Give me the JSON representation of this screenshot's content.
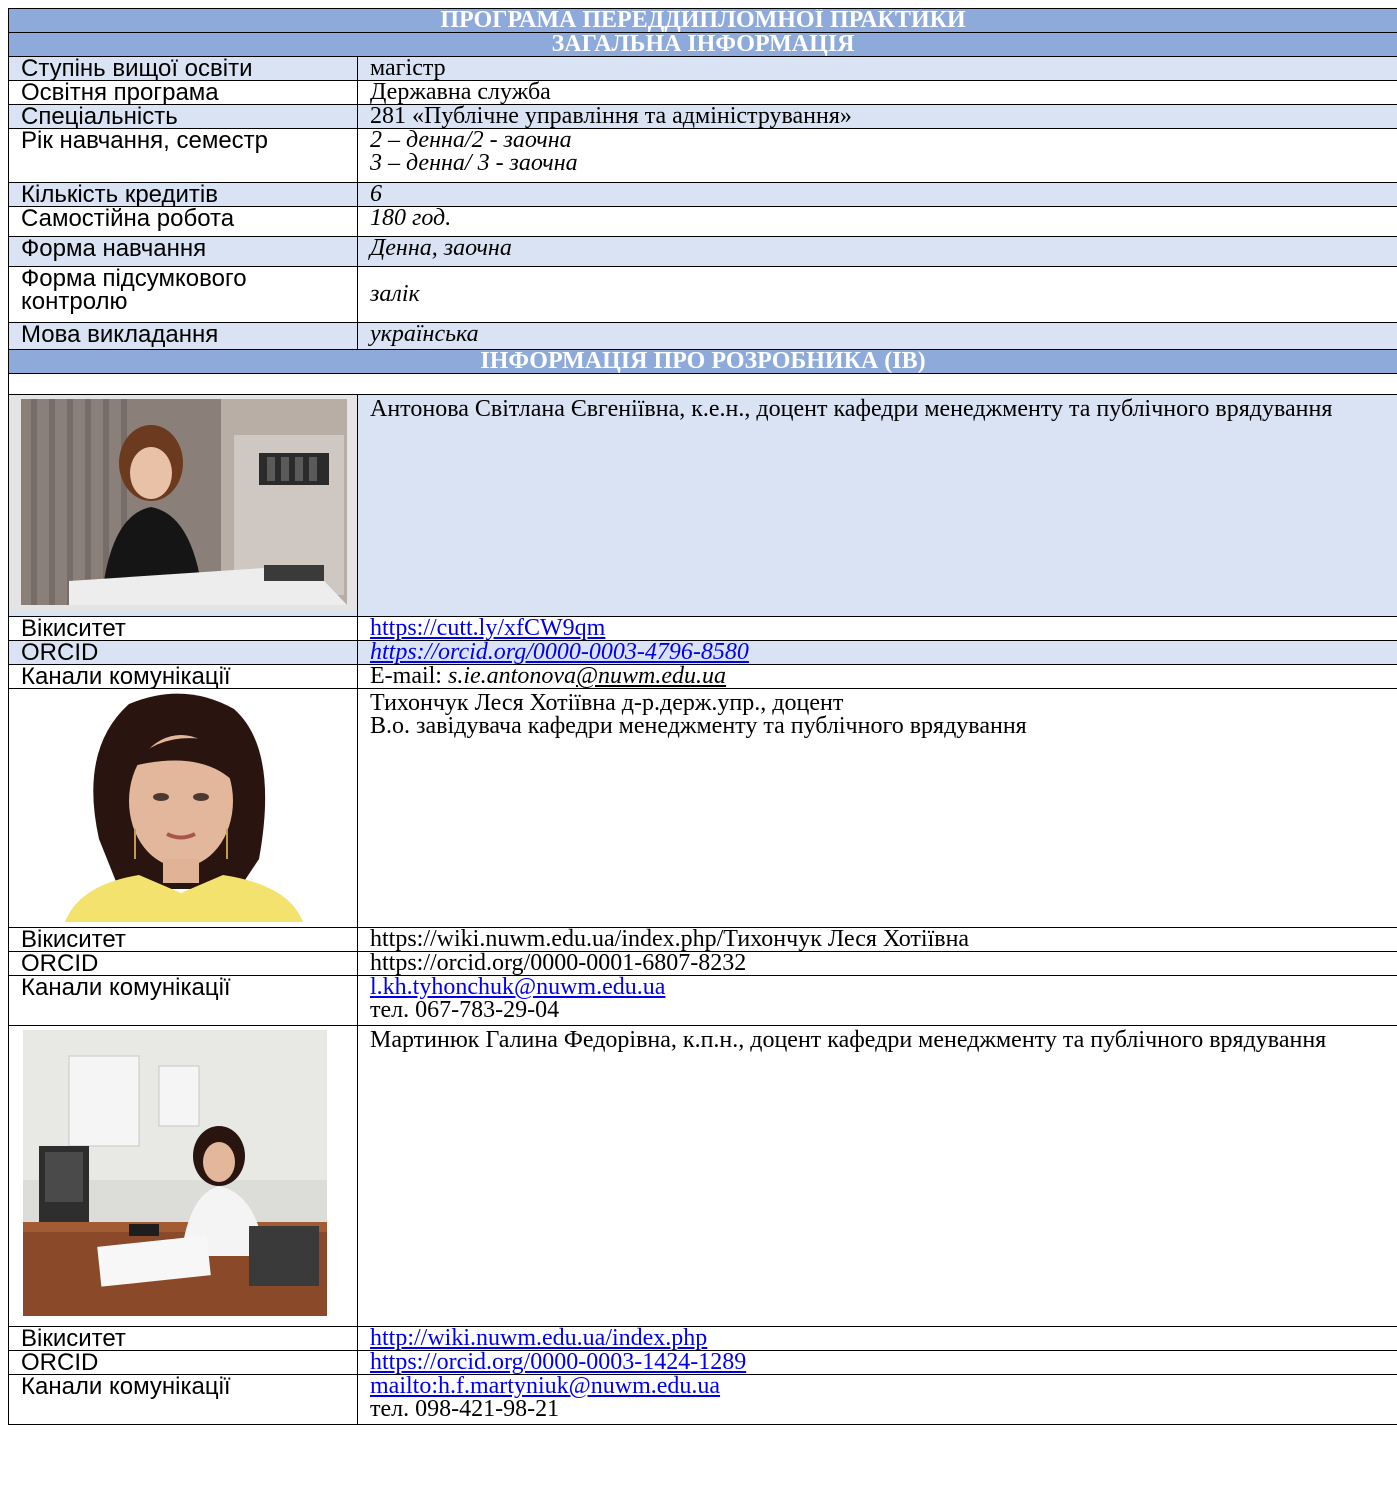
{
  "title": "ПРОГРАМА ПЕРЕДДИПЛОМНОЇ ПРАКТИКИ",
  "general_header": "ЗАГАЛЬНА ІНФОРМАЦІЯ",
  "general_rows": [
    {
      "label": "Ступінь вищої освіти",
      "value": "магістр"
    },
    {
      "label": "Освітня програма",
      "value": "Державна служба"
    },
    {
      "label": "Спеціальність",
      "value": "281 «Публічне управління та адміністрування»"
    },
    {
      "label": "Рік навчання, семестр",
      "value_line1": "2 – денна/2 - заочна",
      "value_line2": "3 – денна/ 3 - заочна"
    },
    {
      "label": "Кількість кредитів",
      "value": "6"
    },
    {
      "label": "Самостійна робота",
      "value": "180 год."
    },
    {
      "label": "Форма навчання",
      "value": "Денна, заочна"
    },
    {
      "label_line1": "Форма підсумкового",
      "label_line2": "контролю",
      "value": "залік"
    },
    {
      "label": "Мова викладання",
      "value": "українська"
    }
  ],
  "developer_header": "ІНФОРМАЦІЯ ПРО РОЗРОБНИКА (ІВ)",
  "developers": [
    {
      "description": "Антонова Світлана Євгеніївна, к.е.н., доцент кафедри менеджменту та публічного врядування",
      "wiki_label": "Вікиситет",
      "wiki_value": "https://cutt.ly/xfCW9qm",
      "orcid_label": "ORCID",
      "orcid_value": "https://orcid.org/0000-0003-4796-8580",
      "contact_label": "Канали комунікації",
      "email_prefix": "E-mail: ",
      "email": "s.ie.antonova",
      "email_domain": "@nuwm.edu.ua"
    },
    {
      "name_line": "Тихончук Леся Хотіївна д-р.держ.упр., доцент",
      "role_line": "В.о. завідувача кафедри менеджменту та публічного врядування",
      "wiki_label": "Вікиситет",
      "wiki_value": "https://wiki.nuwm.edu.ua/index.php/Тихончук Леся Хотіївна",
      "orcid_label": "ORCID",
      "orcid_value": "https://orcid.org/0000-0001-6807-8232",
      "contact_label": "Канали комунікації",
      "email": "l.kh.tyhonchuk@nuwm.edu.ua",
      "phone": "тел. 067-783-29-04"
    },
    {
      "description": "Мартинюк Галина Федорівна, к.п.н.,  доцент кафедри менеджменту та публічного врядування",
      "wiki_label": "Вікиситет",
      "wiki_value": "http://wiki.nuwm.edu.ua/index.php",
      "orcid_label": "ORCID",
      "orcid_value": "https://orcid.org/0000-0003-1424-1289",
      "contact_label": "Канали комунікації",
      "email": "mailto:h.f.martyniuk@nuwm.edu.ua",
      "phone": "тел. 098-421-98-21"
    }
  ]
}
